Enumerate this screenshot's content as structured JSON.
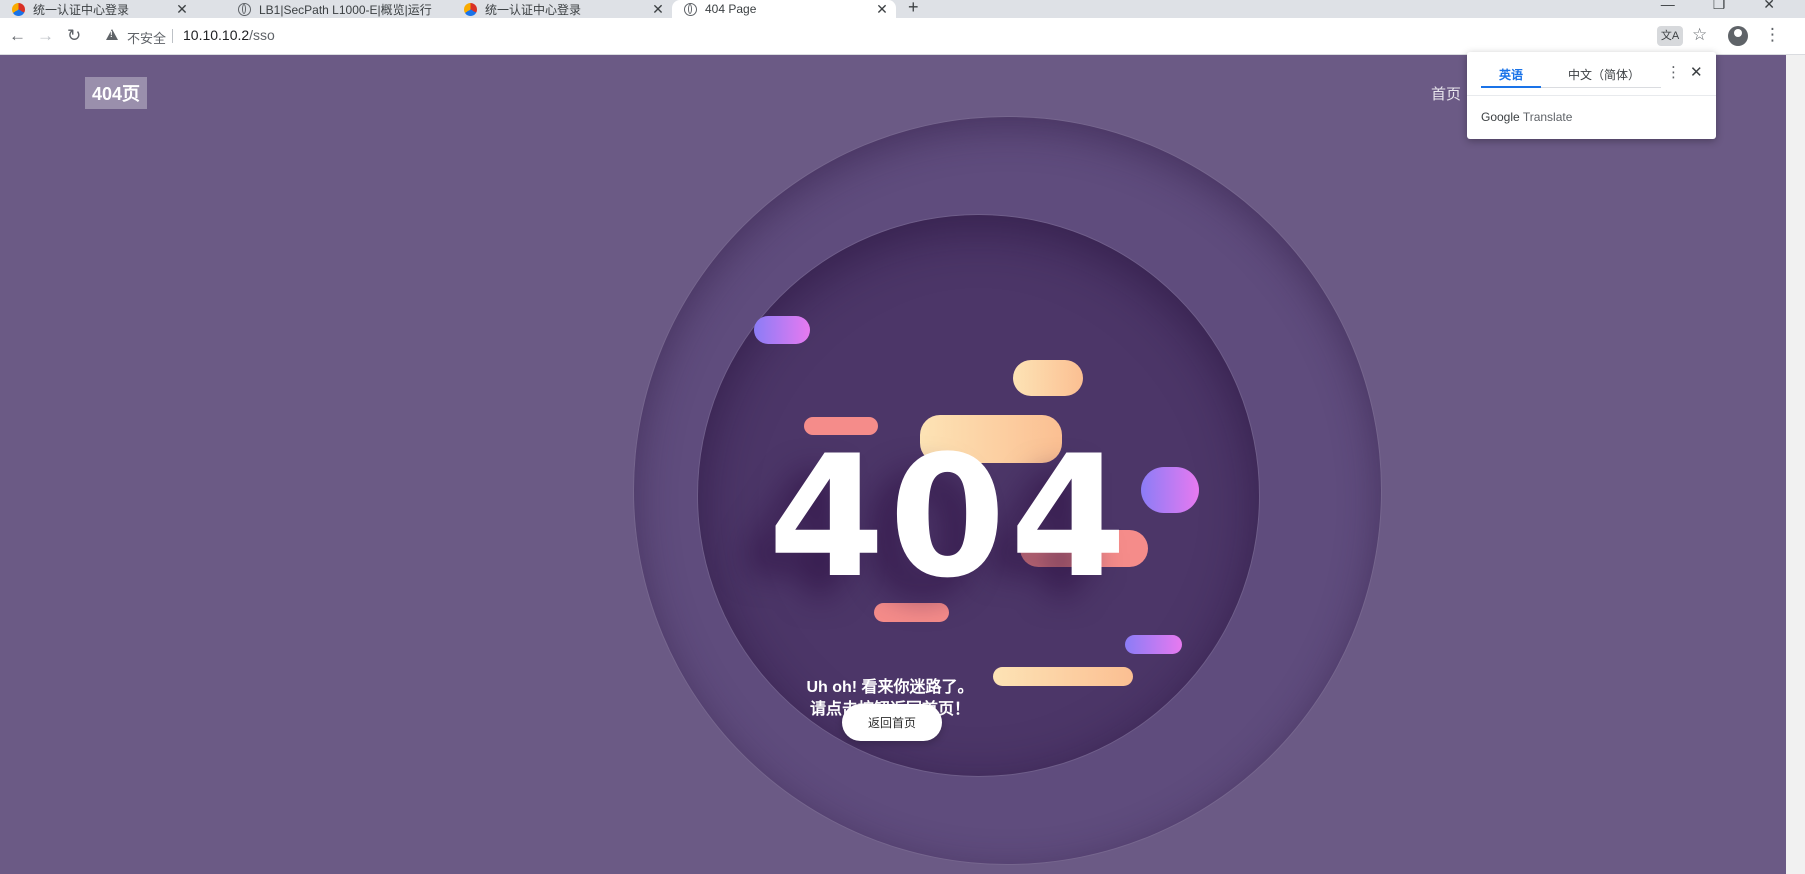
{
  "browser": {
    "tabs": [
      {
        "title": "统一认证中心登录",
        "active": false
      },
      {
        "title": "LB1|SecPath L1000-E|概览|运行",
        "active": false
      },
      {
        "title": "统一认证中心登录",
        "active": false
      },
      {
        "title": "404 Page",
        "active": true
      }
    ],
    "new_tab": "+",
    "security_label": "不安全",
    "url_host": "10.10.10.2",
    "url_path": "/sso"
  },
  "translate_popup": {
    "tab_english": "英语",
    "tab_chinese": "中文（简体）",
    "brand_google": "Google",
    "brand_translate": "Translate"
  },
  "page": {
    "logo": "404页",
    "nav_home": "首页",
    "error_code": "404",
    "message_line1": "Uh oh! 看来你迷路了。",
    "message_line2": "请点击按钮返回首页！",
    "back_button": "返回首页"
  },
  "colors": {
    "background": "#6b5a85",
    "gradient_purple": "#8b7cf6",
    "gradient_pink": "#e77af0",
    "salmon": "#f58c8a",
    "peach": "#fde3b5"
  }
}
